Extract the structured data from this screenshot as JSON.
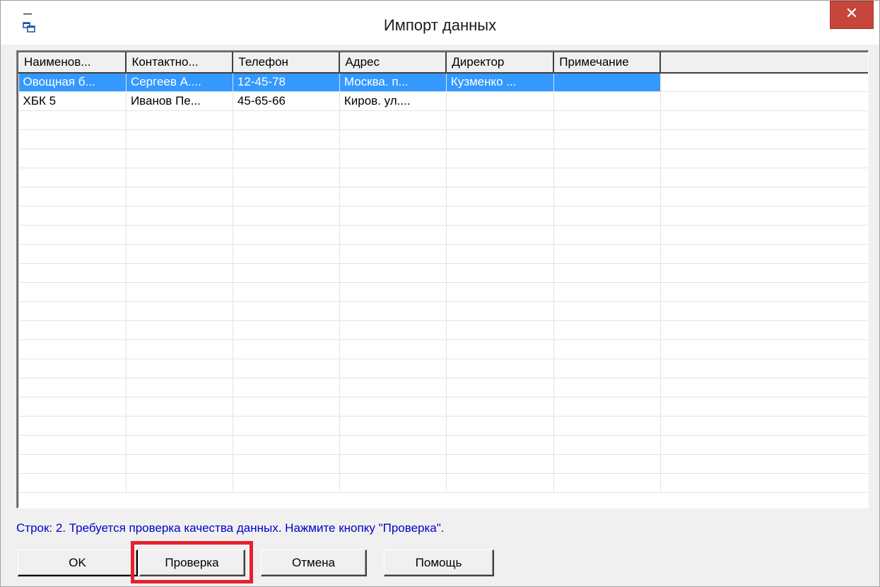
{
  "window": {
    "title": "Импорт данных",
    "close_label": "✕",
    "system_icon": "window-app-icon"
  },
  "grid": {
    "columns": [
      "Наименов...",
      "Контактно...",
      "Телефон",
      "Адрес",
      "Директор",
      "Примечание"
    ],
    "rows": [
      [
        "Овощная б...",
        "Сергеев А....",
        "12-45-78",
        "Москва. п...",
        "Кузменко ...",
        ""
      ],
      [
        "ХБК 5",
        "Иванов Пе...",
        "45-65-66",
        "Киров. ул....",
        "",
        ""
      ]
    ],
    "selected_row": 0,
    "selection_color": "#3399ff"
  },
  "status": {
    "text": "Строк: 2. Требуется проверка качества данных. Нажмите кнопку \"Проверка\"."
  },
  "buttons": {
    "ok": "OK",
    "check": "Проверка",
    "cancel": "Отмена",
    "help": "Помощь"
  },
  "colors": {
    "status_text": "#0000cc",
    "highlight_border": "#e8202a",
    "close_button": "#c7463b"
  }
}
